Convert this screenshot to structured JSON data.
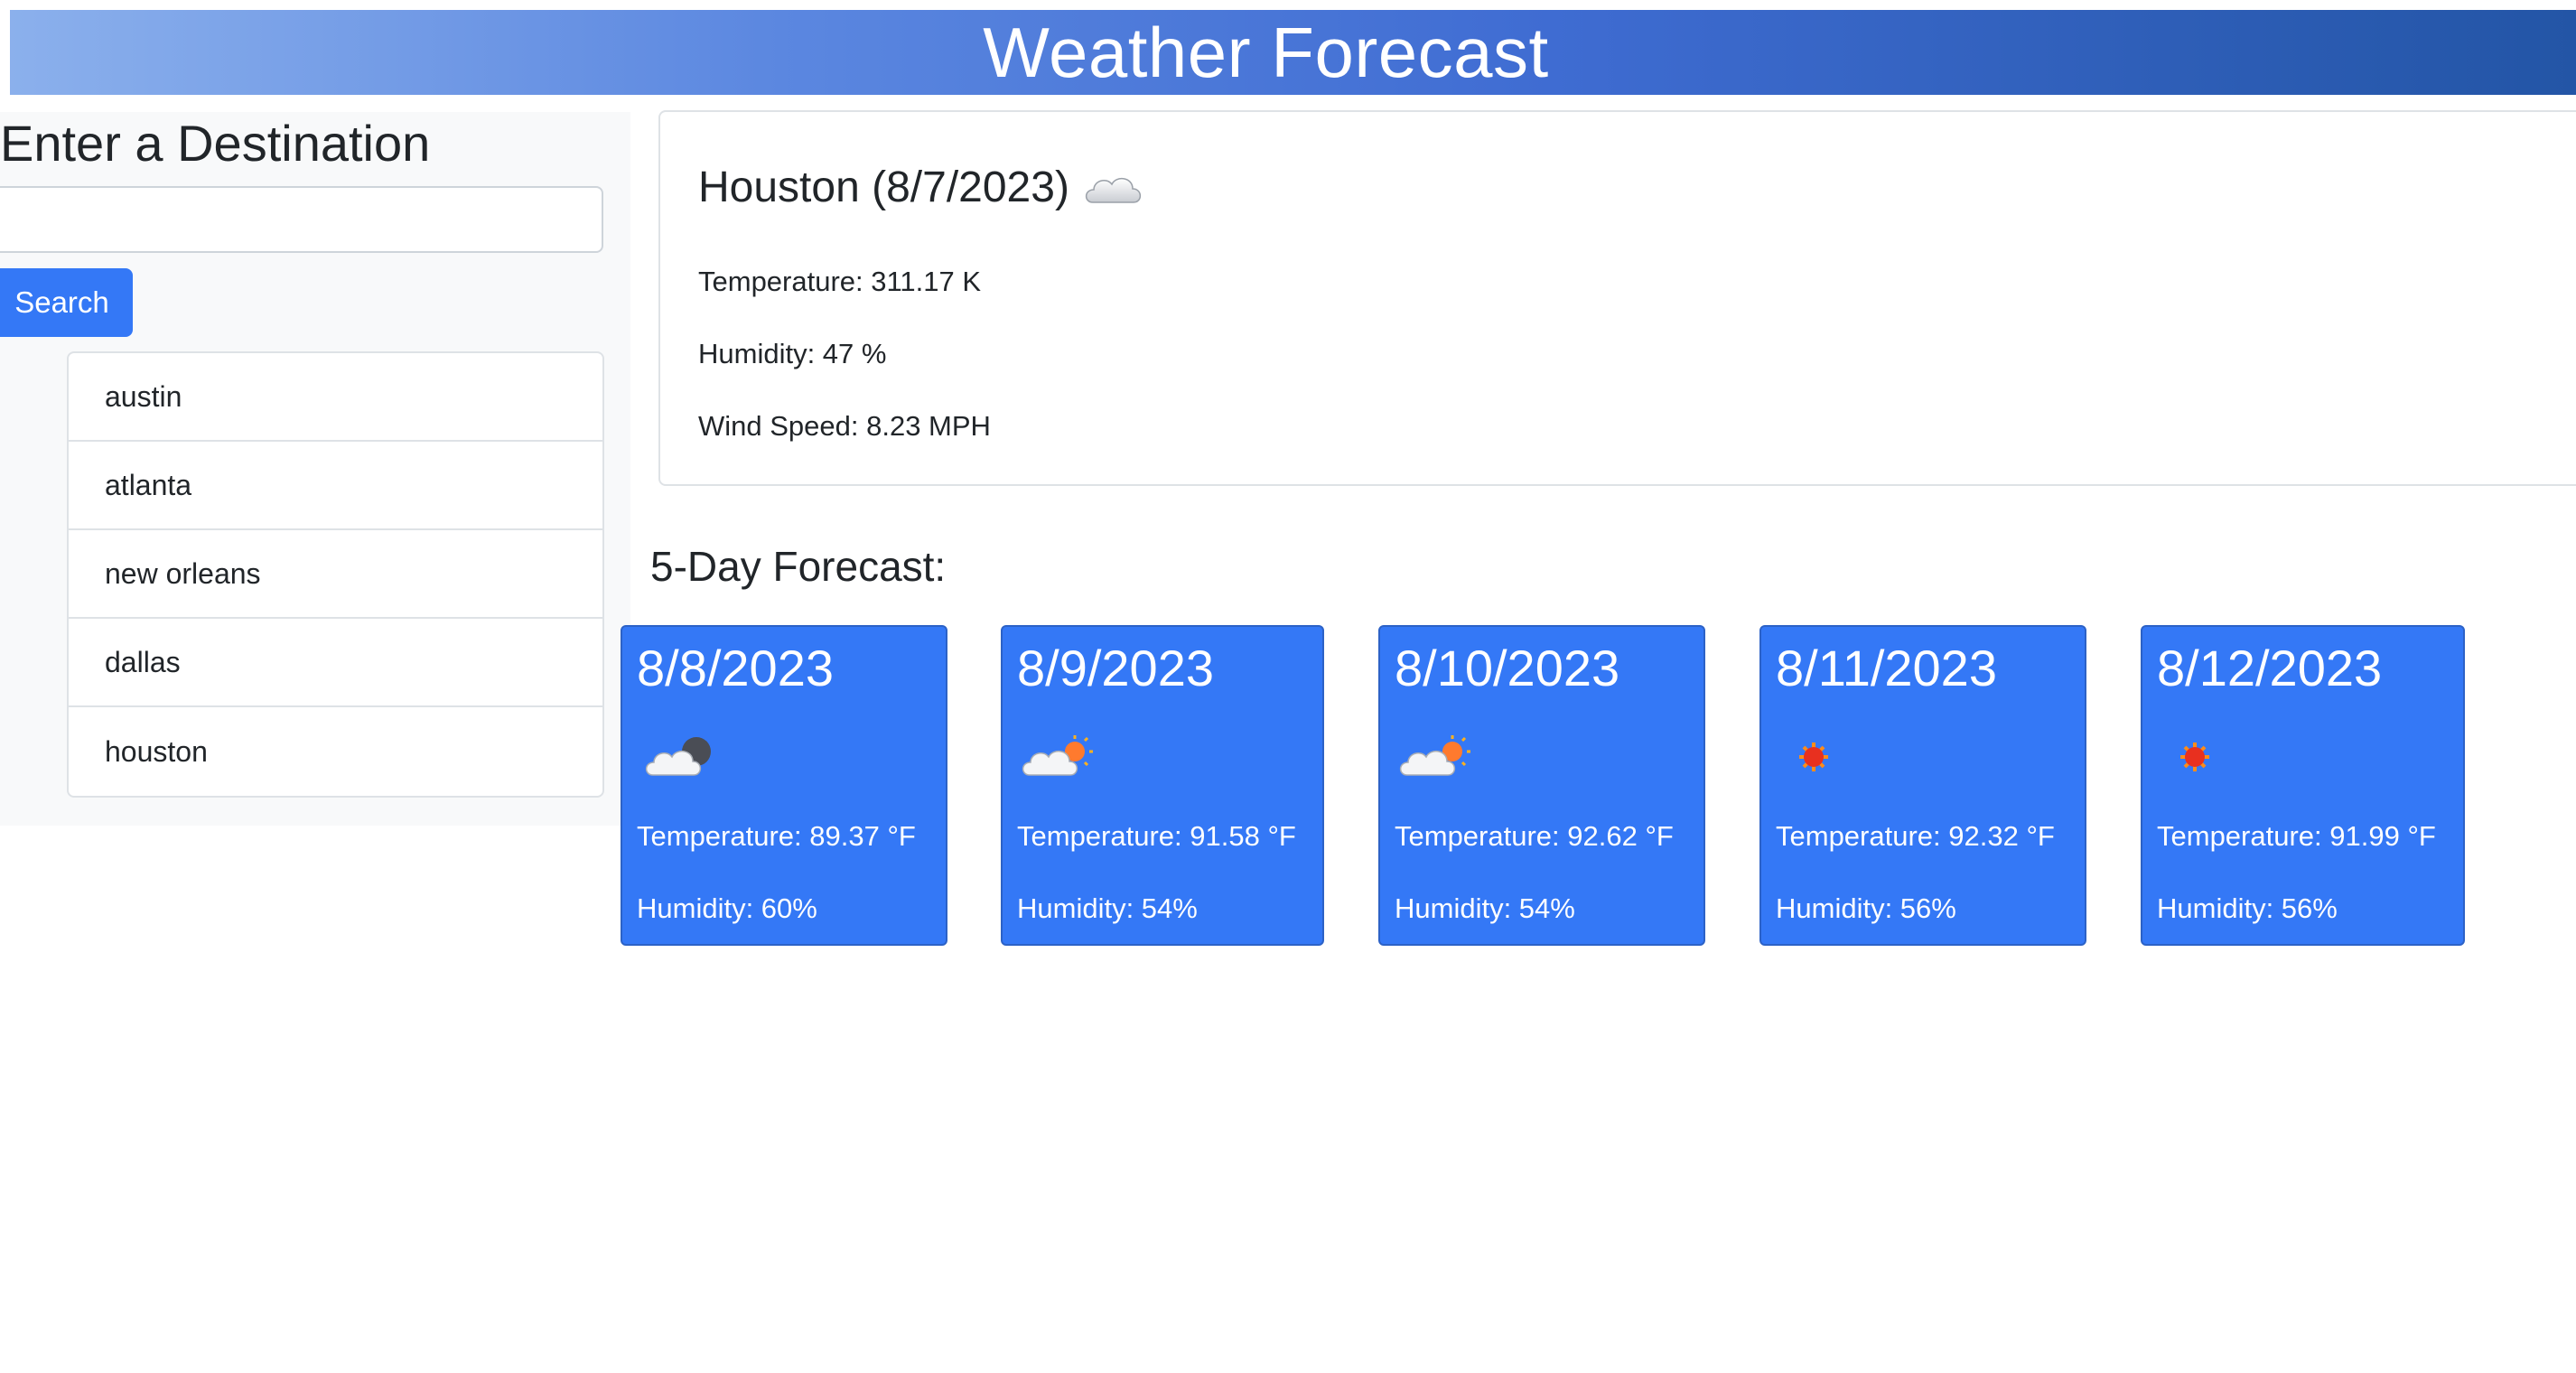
{
  "header": {
    "title": "Weather Forecast"
  },
  "sidebar": {
    "heading": "Enter a Destination",
    "search_input": {
      "value": "",
      "placeholder": ""
    },
    "search_button": "Search",
    "history": [
      "austin",
      "atlanta",
      "new orleans",
      "dallas",
      "houston"
    ]
  },
  "current": {
    "title": "Houston (8/7/2023)",
    "icon": "cloud-icon",
    "temperature": "Temperature: 311.17 K",
    "humidity": "Humidity: 47 %",
    "wind": "Wind Speed: 8.23 MPH"
  },
  "forecast": {
    "heading": "5-Day Forecast:",
    "days": [
      {
        "date": "8/8/2023",
        "icon": "cloud-moon-icon",
        "temperature": "Temperature: 89.37 °F",
        "humidity": "Humidity: 60%"
      },
      {
        "date": "8/9/2023",
        "icon": "cloud-sun-icon",
        "temperature": "Temperature: 91.58 °F",
        "humidity": "Humidity: 54%"
      },
      {
        "date": "8/10/2023",
        "icon": "cloud-sun-icon",
        "temperature": "Temperature: 92.62 °F",
        "humidity": "Humidity: 54%"
      },
      {
        "date": "8/11/2023",
        "icon": "sun-icon",
        "temperature": "Temperature: 92.32 °F",
        "humidity": "Humidity: 56%"
      },
      {
        "date": "8/12/2023",
        "icon": "sun-icon",
        "temperature": "Temperature: 91.99 °F",
        "humidity": "Humidity: 56%"
      }
    ]
  },
  "colors": {
    "accent": "#3478f6",
    "header_start": "#8bb0ec",
    "header_end": "#2355a6",
    "sidebar_bg": "#f8f9fa"
  }
}
